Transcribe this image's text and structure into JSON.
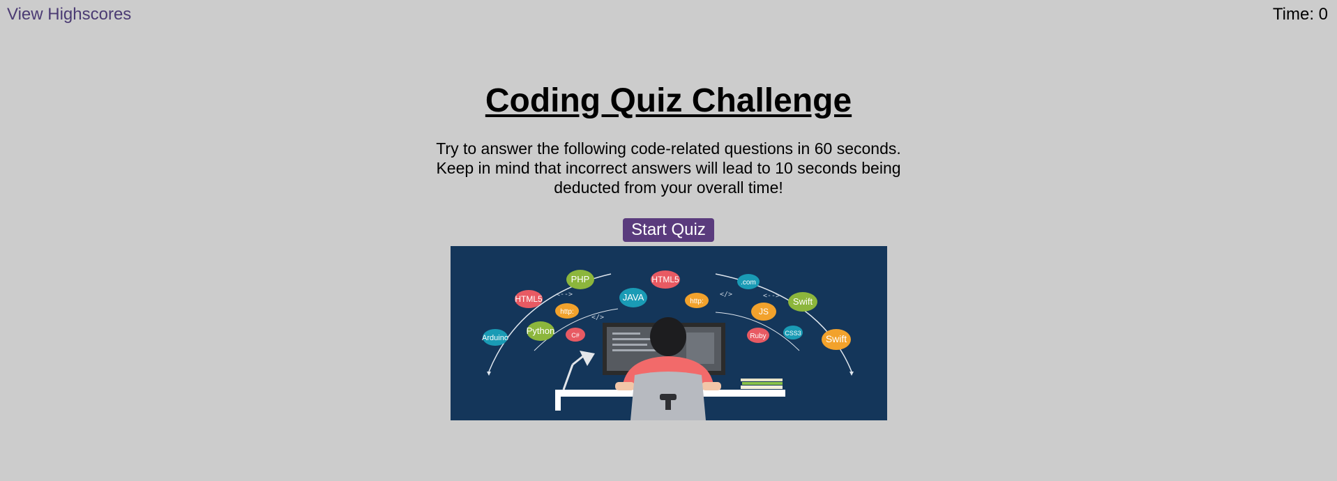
{
  "header": {
    "highscores_link": "View Highscores",
    "timer_label": "Time: 0"
  },
  "main": {
    "title": "Coding Quiz Challenge",
    "intro_text": "Try to answer the following code-related questions in 60 seconds. Keep in mind that incorrect answers will lead to 10 seconds being deducted from your overall time!",
    "start_button": "Start Quiz"
  },
  "illustration": {
    "bubbles": [
      "PHP",
      "HTML5",
      "HTML5",
      "JAVA",
      "http:",
      "http:",
      ".com",
      "Swift",
      "JS",
      "Arduino",
      "Python",
      "C#",
      "Ruby",
      "CSS3",
      "Swift"
    ],
    "code_tags": [
      "<-->",
      "</>",
      "</>",
      "<-->"
    ]
  },
  "colors": {
    "background": "#cccccc",
    "link": "#4b3b73",
    "button": "#5a3b7d",
    "hero_background": "#14365a"
  }
}
